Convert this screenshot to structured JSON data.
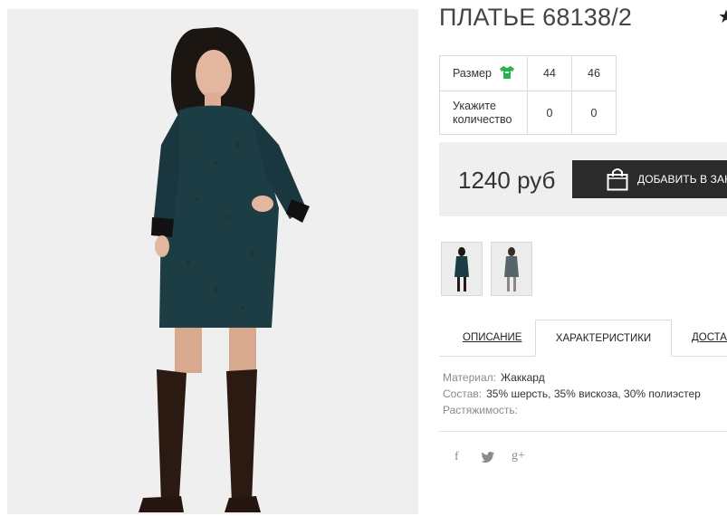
{
  "product": {
    "title": "ПЛАТЬЕ 68138/2",
    "favorite_icon": "star-icon",
    "main_image": "model-in-dark-teal-dress-and-knee-boots",
    "thumbnails": [
      {
        "name": "thumbnail-front"
      },
      {
        "name": "thumbnail-alt"
      }
    ]
  },
  "sizes_table": {
    "size_label": "Размер",
    "size_icon": "tshirt-icon",
    "quantity_label_line1": "Укажите",
    "quantity_label_line2": "количество",
    "sizes": [
      "44",
      "46"
    ],
    "quantities": [
      "0",
      "0"
    ]
  },
  "purchase": {
    "price": "1240 руб",
    "add_to_cart": "ДОБАВИТЬ В ЗАКАЗ",
    "button_icon": "shopping-bag-icon"
  },
  "tabs": {
    "description": "ОПИСАНИЕ",
    "characteristics": "ХАРАКТЕРИСТИКИ",
    "delivery": "ДОСТАВКА",
    "active": "characteristics"
  },
  "specs": {
    "material_label": "Материал:",
    "material_value": "Жаккард",
    "composition_label": "Состав:",
    "composition_value": "35% шерсть, 35% вискоза, 30% полиэстер",
    "stretch_label": "Растяжимость:"
  },
  "social": {
    "facebook": "f",
    "twitter_icon": "twitter-icon",
    "googleplus": "g+"
  },
  "colors": {
    "accent_icon": "#27b34a",
    "button_bg": "#2b2b2b",
    "price_bg": "#efefef"
  }
}
